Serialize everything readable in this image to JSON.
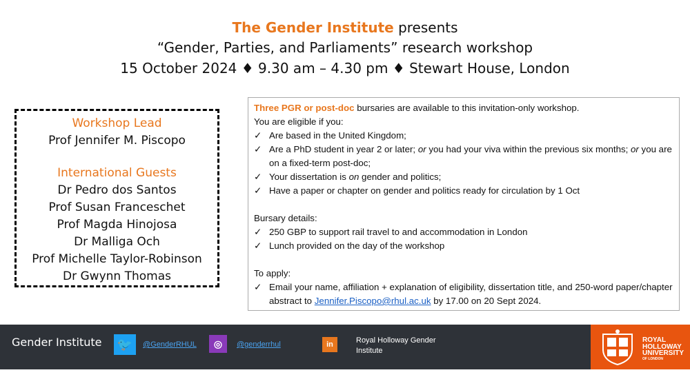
{
  "header": {
    "org": "The Gender Institute",
    "presents": " presents",
    "title": "“Gender, Parties, and Parliaments” research workshop",
    "details": "15 October 2024 ♦ 9.30 am – 4.30 pm ♦ Stewart House, London"
  },
  "people": {
    "lead_heading": "Workshop Lead",
    "lead": "Prof Jennifer M. Piscopo",
    "guests_heading": "International Guests",
    "guests": [
      "Dr Pedro dos Santos",
      "Prof Susan Franceschet",
      "Prof Magda Hinojosa",
      "Dr Malliga Och",
      "Prof Michelle Taylor-Robinson",
      "Dr Gwynn Thomas"
    ]
  },
  "info": {
    "intro_highlight": "Three PGR or post-doc",
    "intro_rest": " bursaries are available to this invitation-only workshop.",
    "eligible_heading": "You are eligible if you:",
    "tick": "✓",
    "elig1": "Are based in the United Kingdom;",
    "elig2_a": "Are a PhD student in year 2 or later; ",
    "elig2_or1": "or",
    "elig2_b": " you had your viva within the previous six months; ",
    "elig2_or2": "or",
    "elig2_c": " you are on a fixed-term post-doc;",
    "elig3_a": "Your dissertation is ",
    "elig3_on": "on",
    "elig3_b": " gender and politics;",
    "elig4": "Have a paper or chapter on gender and politics ready for circulation by 1 Oct",
    "bursary_heading": "Bursary details:",
    "bursary1": "250 GBP to support rail travel to and accommodation in London",
    "bursary2": "Lunch provided on the day of the workshop",
    "apply_heading": "To apply:",
    "apply_a": "Email your name, affiliation + explanation of eligibility, dissertation title, and 250-word paper/chapter abstract to ",
    "apply_email": "Jennifer.Piscopo@rhul.ac.uk",
    "apply_b": " by 17.00 on 20 Sept 2024."
  },
  "footer": {
    "label": "Gender Institute",
    "twitter_icon": "twitter-icon",
    "twitter_glyph": "🐦",
    "twitter_handle": "@GenderRHUL",
    "instagram_icon": "instagram-icon",
    "instagram_glyph": "◎",
    "instagram_handle": "@genderrhul",
    "linkedin_icon": "linkedin-icon",
    "linkedin_glyph": "in",
    "linkedin_name": "Royal Holloway Gender Institute",
    "logo_line1": "ROYAL",
    "logo_line2": "HOLLOWAY",
    "logo_line3": "UNIVERSITY",
    "logo_line4": "OF LONDON"
  },
  "colors": {
    "accent": "#e8771e",
    "footer_bg": "#2e3238",
    "logo_bg": "#e8550f"
  }
}
